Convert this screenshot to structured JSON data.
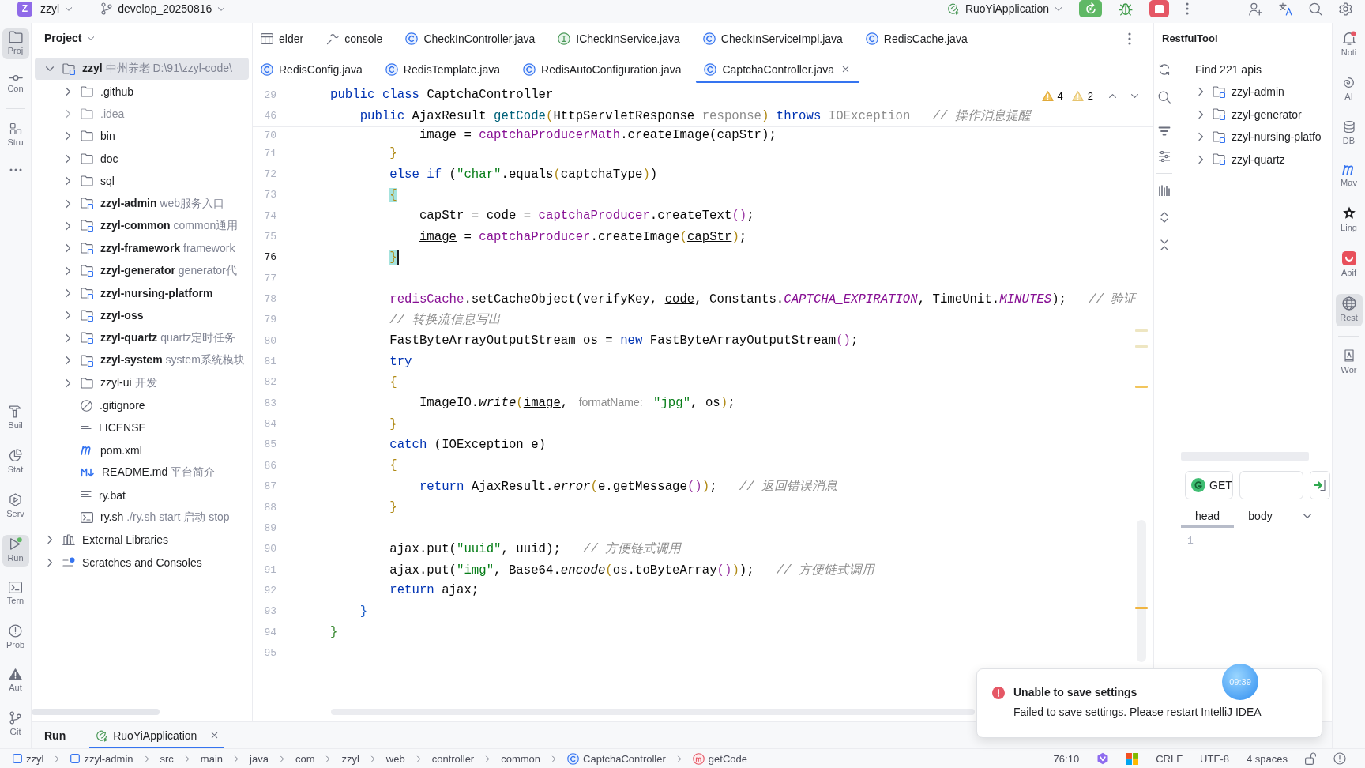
{
  "title_bar": {
    "project_badge": "Z",
    "project": "zzyl",
    "branch": "develop_20250816",
    "run_configuration": "RuoYiApplication"
  },
  "left_toolbar": {
    "top_groups": [
      [
        {
          "kind": "project",
          "label": "Proj",
          "selected": true
        },
        {
          "kind": "commit",
          "label": "Con",
          "selected": false
        }
      ],
      [
        {
          "kind": "structure",
          "label": "Stru",
          "selected": false
        },
        {
          "kind": "more",
          "selected": false
        }
      ]
    ],
    "bottom": [
      {
        "kind": "build",
        "label": "Buil",
        "selected": false
      },
      {
        "kind": "profiler",
        "label": "Stat",
        "selected": false
      },
      {
        "kind": "services",
        "label": "Serv",
        "selected": false
      },
      {
        "kind": "run",
        "label": "Run",
        "selected": true
      },
      {
        "kind": "terminal",
        "label": "Tern",
        "selected": false
      },
      {
        "kind": "problems",
        "label": "Prob",
        "selected": false
      },
      {
        "kind": "warnings",
        "label": "Aut",
        "selected": false
      },
      {
        "kind": "git",
        "label": "Git",
        "selected": false
      }
    ]
  },
  "project_panel": {
    "title": "Project",
    "tree": [
      {
        "kind": "module",
        "name": "zzyl",
        "description": "中州养老",
        "path": "D:\\91\\zzyl-code\\",
        "expanded": true,
        "selected": true,
        "children": [
          {
            "kind": "folder",
            "name": ".github",
            "expanded": false,
            "selected": false
          },
          {
            "kind": "excluded-folder",
            "name": ".idea",
            "expanded": false,
            "selected": false
          },
          {
            "kind": "folder",
            "name": "bin",
            "expanded": false,
            "selected": false
          },
          {
            "kind": "folder",
            "name": "doc",
            "expanded": false,
            "selected": false
          },
          {
            "kind": "folder",
            "name": "sql",
            "expanded": false,
            "selected": false
          },
          {
            "kind": "module",
            "name": "zzyl-admin",
            "description": "web服务入口",
            "expanded": false,
            "selected": false
          },
          {
            "kind": "module",
            "name": "zzyl-common",
            "description": "common通用",
            "expanded": false,
            "selected": false
          },
          {
            "kind": "module",
            "name": "zzyl-framework",
            "description": "framework",
            "expanded": false,
            "selected": false
          },
          {
            "kind": "module",
            "name": "zzyl-generator",
            "description": "generator代",
            "expanded": false,
            "selected": false
          },
          {
            "kind": "module",
            "name": "zzyl-nursing-platform",
            "expanded": false,
            "selected": false
          },
          {
            "kind": "module",
            "name": "zzyl-oss",
            "expanded": false,
            "selected": false
          },
          {
            "kind": "module",
            "name": "zzyl-quartz",
            "description": "quartz定时任务",
            "expanded": false,
            "selected": false
          },
          {
            "kind": "module",
            "name": "zzyl-system",
            "description": "system系统模块",
            "expanded": false,
            "selected": false
          },
          {
            "kind": "folder",
            "name": "zzyl-ui",
            "description": "开发",
            "expanded": false,
            "selected": false
          },
          {
            "kind": "gitignore",
            "name": ".gitignore",
            "selected": false
          },
          {
            "kind": "text",
            "name": "LICENSE",
            "selected": false
          },
          {
            "kind": "maven",
            "name": "pom.xml",
            "selected": false
          },
          {
            "kind": "markdown",
            "name": "README.md",
            "description": "平台简介",
            "selected": false
          },
          {
            "kind": "text",
            "name": "ry.bat",
            "selected": false
          },
          {
            "kind": "shell",
            "name": "ry.sh",
            "description": "./ry.sh start 启动 stop",
            "selected": false
          }
        ]
      },
      {
        "kind": "libraries",
        "name": "External Libraries",
        "expanded": false,
        "selected": false
      },
      {
        "kind": "scratches",
        "name": "Scratches and Consoles",
        "expanded": false,
        "selected": false
      }
    ]
  },
  "editor": {
    "tab_rows": [
      {
        "tabs": [
          {
            "kind": "table",
            "label": "elder",
            "selected": false
          },
          {
            "kind": "console",
            "label": "console",
            "selected": false
          },
          {
            "kind": "class",
            "label": "CheckInController.java",
            "selected": false
          },
          {
            "kind": "interface",
            "label": "ICheckInService.java",
            "selected": false
          },
          {
            "kind": "class",
            "label": "CheckInServiceImpl.java",
            "selected": false
          },
          {
            "kind": "class",
            "label": "RedisCache.java",
            "selected": false
          }
        ]
      },
      {
        "tabs": [
          {
            "kind": "class",
            "label": "RedisConfig.java",
            "selected": false
          },
          {
            "kind": "class",
            "label": "RedisTemplate.java",
            "selected": false
          },
          {
            "kind": "class",
            "label": "RedisAutoConfiguration.java",
            "selected": false
          },
          {
            "kind": "class",
            "label": "CaptchaController.java",
            "selected": true
          }
        ]
      }
    ],
    "inspections": {
      "warnings": "4",
      "weak_warnings": "2"
    },
    "sticky_lines": [
      {
        "number": "29",
        "current": false,
        "tokens": [
          {
            "kind": "keyword",
            "text": "public class"
          },
          {
            "kind": "plain",
            "text": " CaptchaController"
          }
        ]
      },
      {
        "number": "46",
        "current": false,
        "tokens": [
          {
            "kind": "keyword",
            "text": "    public"
          },
          {
            "kind": "plain",
            "text": " AjaxResult "
          },
          {
            "kind": "method",
            "text": "getCode"
          },
          {
            "kind": "bracket_1",
            "text": "("
          },
          {
            "kind": "plain",
            "text": "HttpServletResponse "
          },
          {
            "kind": "unused",
            "text": "response"
          },
          {
            "kind": "bracket_1",
            "text": ")"
          },
          {
            "kind": "keyword",
            "text": " throws"
          },
          {
            "kind": "unused",
            "text": " IOException"
          },
          {
            "kind": "comment",
            "text": "   // 操作消息提醒"
          }
        ]
      }
    ],
    "lines": [
      {
        "number": "70",
        "current": false,
        "tokens": [
          {
            "kind": "plain",
            "text": "            image = "
          },
          {
            "kind": "field",
            "text": "captchaProducerMath"
          },
          {
            "kind": "plain",
            "text": ".createImage(capStr);"
          }
        ]
      },
      {
        "number": "71",
        "current": false,
        "tokens": [
          {
            "kind": "bracket_1",
            "text": "        }"
          }
        ]
      },
      {
        "number": "72",
        "current": false,
        "tokens": [
          {
            "kind": "keyword",
            "text": "        else if"
          },
          {
            "kind": "plain",
            "text": " ("
          },
          {
            "kind": "string",
            "text": "\"char\""
          },
          {
            "kind": "plain",
            "text": ".equals"
          },
          {
            "kind": "bracket_1",
            "text": "("
          },
          {
            "kind": "plain",
            "text": "captchaType"
          },
          {
            "kind": "bracket_1",
            "text": ")"
          },
          {
            "kind": "plain",
            "text": ")"
          }
        ]
      },
      {
        "number": "73",
        "current": false,
        "tokens": [
          {
            "kind": "brace_match",
            "text": "        {"
          }
        ]
      },
      {
        "number": "74",
        "current": false,
        "tokens": [
          {
            "kind": "reassigned",
            "text": "            capStr"
          },
          {
            "kind": "plain",
            "text": " = "
          },
          {
            "kind": "reassigned",
            "text": "code"
          },
          {
            "kind": "plain",
            "text": " = "
          },
          {
            "kind": "field",
            "text": "captchaProducer"
          },
          {
            "kind": "plain",
            "text": ".createText"
          },
          {
            "kind": "bracket_2",
            "text": "()"
          },
          {
            "kind": "plain",
            "text": ";"
          }
        ]
      },
      {
        "number": "75",
        "current": false,
        "tokens": [
          {
            "kind": "reassigned",
            "text": "            image"
          },
          {
            "kind": "plain",
            "text": " = "
          },
          {
            "kind": "field",
            "text": "captchaProducer"
          },
          {
            "kind": "plain",
            "text": ".createImage"
          },
          {
            "kind": "bracket_1",
            "text": "("
          },
          {
            "kind": "reassigned",
            "text": "capStr"
          },
          {
            "kind": "bracket_1",
            "text": ")"
          },
          {
            "kind": "plain",
            "text": ";"
          }
        ]
      },
      {
        "number": "76",
        "current": true,
        "tokens": [
          {
            "kind": "brace_match",
            "text": "        }"
          }
        ]
      },
      {
        "number": "77",
        "current": false
      },
      {
        "number": "78",
        "current": false,
        "tokens": [
          {
            "kind": "field",
            "text": "        redisCache"
          },
          {
            "kind": "plain",
            "text": ".setCacheObject(verifyKey, "
          },
          {
            "kind": "reassigned",
            "text": "code"
          },
          {
            "kind": "plain",
            "text": ", Constants."
          },
          {
            "kind": "constant",
            "text": "CAPTCHA_EXPIRATION"
          },
          {
            "kind": "plain",
            "text": ", TimeUnit."
          },
          {
            "kind": "constant",
            "text": "MINUTES"
          },
          {
            "kind": "plain",
            "text": ");"
          },
          {
            "kind": "comment",
            "text": "   // 验证"
          }
        ]
      },
      {
        "number": "79",
        "current": false,
        "tokens": [
          {
            "kind": "comment",
            "text": "        // 转换流信息写出"
          }
        ]
      },
      {
        "number": "80",
        "current": false,
        "tokens": [
          {
            "kind": "plain",
            "text": "        FastByteArrayOutputStream os = "
          },
          {
            "kind": "keyword",
            "text": "new"
          },
          {
            "kind": "plain",
            "text": " FastByteArrayOutputStream"
          },
          {
            "kind": "bracket_2",
            "text": "()"
          },
          {
            "kind": "plain",
            "text": ";"
          }
        ]
      },
      {
        "number": "81",
        "current": false,
        "tokens": [
          {
            "kind": "keyword",
            "text": "        try"
          }
        ]
      },
      {
        "number": "82",
        "current": false,
        "tokens": [
          {
            "kind": "bracket_1",
            "text": "        {"
          }
        ]
      },
      {
        "number": "83",
        "current": false,
        "tokens": [
          {
            "kind": "plain",
            "text": "            ImageIO."
          },
          {
            "kind": "static_call",
            "text": "write"
          },
          {
            "kind": "bracket_1",
            "text": "("
          },
          {
            "kind": "reassigned",
            "text": "image"
          },
          {
            "kind": "plain",
            "text": ", "
          },
          {
            "kind": "hint",
            "text": "formatName:"
          },
          {
            "kind": "string",
            "text": " \"jpg\""
          },
          {
            "kind": "plain",
            "text": ", os"
          },
          {
            "kind": "bracket_1",
            "text": ")"
          },
          {
            "kind": "plain",
            "text": ";"
          }
        ]
      },
      {
        "number": "84",
        "current": false,
        "tokens": [
          {
            "kind": "bracket_1",
            "text": "        }"
          }
        ]
      },
      {
        "number": "85",
        "current": false,
        "tokens": [
          {
            "kind": "keyword",
            "text": "        catch"
          },
          {
            "kind": "plain",
            "text": " (IOException e)"
          }
        ]
      },
      {
        "number": "86",
        "current": false,
        "tokens": [
          {
            "kind": "bracket_1",
            "text": "        {"
          }
        ]
      },
      {
        "number": "87",
        "current": false,
        "tokens": [
          {
            "kind": "keyword",
            "text": "            return"
          },
          {
            "kind": "plain",
            "text": " AjaxResult."
          },
          {
            "kind": "static_call",
            "text": "error"
          },
          {
            "kind": "bracket_1",
            "text": "("
          },
          {
            "kind": "plain",
            "text": "e.getMessage"
          },
          {
            "kind": "bracket_2",
            "text": "()"
          },
          {
            "kind": "bracket_1",
            "text": ")"
          },
          {
            "kind": "plain",
            "text": ";"
          },
          {
            "kind": "comment",
            "text": "   // 返回错误消息"
          }
        ]
      },
      {
        "number": "88",
        "current": false,
        "tokens": [
          {
            "kind": "bracket_1",
            "text": "        }"
          }
        ]
      },
      {
        "number": "89",
        "current": false
      },
      {
        "number": "90",
        "current": false,
        "tokens": [
          {
            "kind": "plain",
            "text": "        ajax.put("
          },
          {
            "kind": "string",
            "text": "\"uuid\""
          },
          {
            "kind": "plain",
            "text": ", uuid);"
          },
          {
            "kind": "comment",
            "text": "   // 方便链式调用"
          }
        ]
      },
      {
        "number": "91",
        "current": false,
        "tokens": [
          {
            "kind": "plain",
            "text": "        ajax.put("
          },
          {
            "kind": "string",
            "text": "\"img\""
          },
          {
            "kind": "plain",
            "text": ", Base64."
          },
          {
            "kind": "static_call",
            "text": "encode"
          },
          {
            "kind": "bracket_1",
            "text": "("
          },
          {
            "kind": "plain",
            "text": "os.toByteArray"
          },
          {
            "kind": "bracket_2",
            "text": "()"
          },
          {
            "kind": "bracket_1",
            "text": ")"
          },
          {
            "kind": "plain",
            "text": ");"
          },
          {
            "kind": "comment",
            "text": "   // 方便链式调用"
          }
        ]
      },
      {
        "number": "92",
        "current": false,
        "tokens": [
          {
            "kind": "keyword",
            "text": "        return"
          },
          {
            "kind": "plain",
            "text": " ajax;"
          }
        ]
      },
      {
        "number": "93",
        "current": false,
        "tokens": [
          {
            "kind": "bracket_3",
            "text": "    }"
          }
        ]
      },
      {
        "number": "94",
        "current": false,
        "tokens": [
          {
            "kind": "bracket_4",
            "text": "}"
          }
        ]
      },
      {
        "number": "95",
        "current": false
      }
    ]
  },
  "restful_tool": {
    "title": "RestfulTool",
    "summary": "Find 221 apis",
    "modules": [
      {
        "name": "zzyl-admin",
        "expanded": false,
        "selected": false
      },
      {
        "name": "zzyl-generator",
        "expanded": false,
        "selected": false
      },
      {
        "name": "zzyl-nursing-platfo",
        "expanded": false,
        "selected": false
      },
      {
        "name": "zzyl-quartz",
        "expanded": false,
        "selected": false
      }
    ],
    "request": {
      "method": "GET"
    },
    "tabs": [
      {
        "label": "head",
        "selected": true
      },
      {
        "label": "body",
        "selected": false
      }
    ],
    "body_lines": [
      "1"
    ]
  },
  "right_toolbar": {
    "groups": [
      [
        {
          "kind": "notifications",
          "label": "Noti",
          "selected": false
        },
        {
          "kind": "ai",
          "label": "AI",
          "selected": false
        },
        {
          "kind": "database",
          "label": "DB",
          "selected": false
        },
        {
          "kind": "maven",
          "label": "Mav",
          "selected": false
        },
        {
          "kind": "lingma",
          "label": "Ling",
          "selected": false
        },
        {
          "kind": "apifox",
          "label": "Apif",
          "selected": false
        },
        {
          "kind": "rest",
          "label": "Rest",
          "selected": true
        }
      ],
      [
        {
          "kind": "word",
          "label": "Wor",
          "selected": false
        }
      ]
    ]
  },
  "run_panel": {
    "title": "Run",
    "tabs": [
      {
        "label": "RuoYiApplication",
        "selected": true
      }
    ]
  },
  "notification": {
    "title": "Unable to save settings",
    "message": "Failed to save settings. Please restart IntelliJ IDEA"
  },
  "timer_badge": "09:39",
  "status_bar": {
    "breadcrumbs": [
      {
        "kind": "module",
        "label": "zzyl"
      },
      {
        "kind": "module",
        "label": "zzyl-admin"
      },
      {
        "kind": "package",
        "label": "src"
      },
      {
        "kind": "package",
        "label": "main"
      },
      {
        "kind": "package",
        "label": "java"
      },
      {
        "kind": "package",
        "label": "com"
      },
      {
        "kind": "package",
        "label": "zzyl"
      },
      {
        "kind": "package",
        "label": "web"
      },
      {
        "kind": "package",
        "label": "controller"
      },
      {
        "kind": "package",
        "label": "common"
      },
      {
        "kind": "class",
        "label": "CaptchaController"
      },
      {
        "kind": "method",
        "label": "getCode"
      }
    ],
    "caret_position": "76:10",
    "line_separator": "CRLF",
    "encoding": "UTF-8",
    "indent": "4 spaces"
  }
}
